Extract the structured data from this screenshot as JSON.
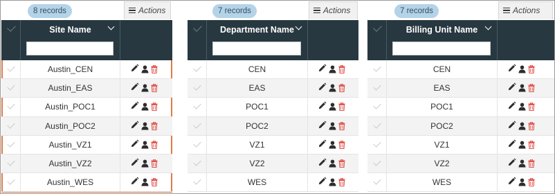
{
  "panels": [
    {
      "record_count": "8 records",
      "actions_label": "Actions",
      "column_title": "Site Name",
      "filter_value": "",
      "rows": [
        "Austin_CEN",
        "Austin_EAS",
        "Austin_POC1",
        "Austin_POC2",
        "Austin_VZ1",
        "Austin_VZ2",
        "Austin_WES"
      ]
    },
    {
      "record_count": "7 records",
      "actions_label": "Actions",
      "column_title": "Department Name",
      "filter_value": "",
      "rows": [
        "CEN",
        "EAS",
        "POC1",
        "POC2",
        "VZ1",
        "VZ2",
        "WES"
      ]
    },
    {
      "record_count": "7 records",
      "actions_label": "Actions",
      "column_title": "Billing Unit Name",
      "filter_value": "",
      "rows": [
        "CEN",
        "EAS",
        "POC1",
        "POC2",
        "VZ1",
        "VZ2",
        "WES"
      ]
    }
  ],
  "row_action_icons": [
    "pencil-icon",
    "user-icon",
    "trash-icon"
  ],
  "colors": {
    "header_bg": "#283840",
    "badge_bg": "#b4d3e8",
    "highlight_border": "#e07a45",
    "trash_icon": "#e0504a",
    "row_alt_bg": "#f3f3f3"
  }
}
